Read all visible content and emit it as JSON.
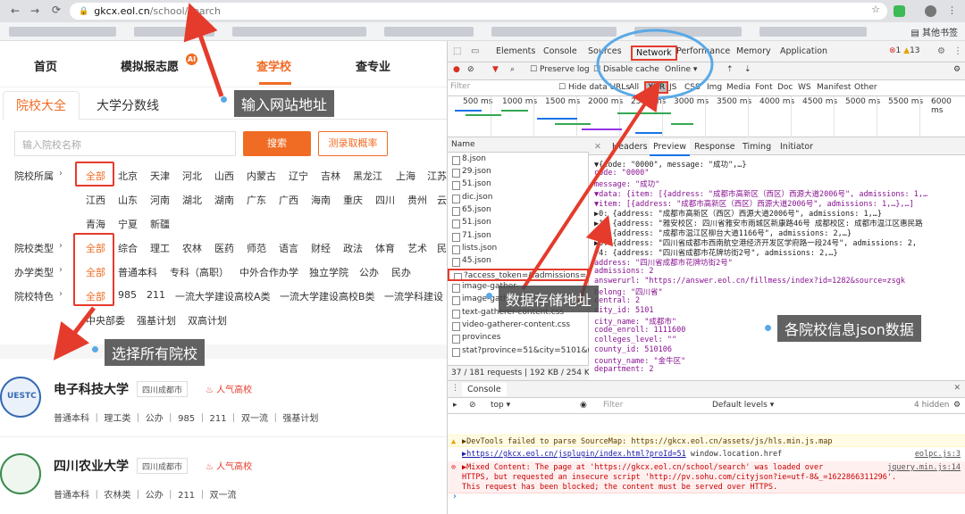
{
  "browser": {
    "url_host": "gkcx.eol.cn",
    "url_path": "/school/search",
    "bookmarks_folder": "其他书签"
  },
  "site": {
    "nav": [
      "首页",
      "模拟报志愿",
      "查学校",
      "查专业"
    ],
    "nav_badge": "AI",
    "tabs": [
      "院校大全",
      "大学分数线"
    ],
    "search_placeholder": "输入院校名称",
    "search_button": "搜索",
    "test_button": "测录取概率",
    "filters": {
      "location": {
        "label": "院校所属",
        "options": [
          "全部",
          "北京",
          "天津",
          "河北",
          "山西",
          "内蒙古",
          "辽宁",
          "吉林",
          "黑龙江",
          "上海",
          "江苏",
          "江西",
          "山东",
          "河南",
          "湖北",
          "湖南",
          "广东",
          "广西",
          "海南",
          "重庆",
          "四川",
          "贵州",
          "云",
          "青海",
          "宁夏",
          "新疆"
        ]
      },
      "type": {
        "label": "院校类型",
        "options": [
          "全部",
          "综合",
          "理工",
          "农林",
          "医药",
          "师范",
          "语言",
          "财经",
          "政法",
          "体育",
          "艺术",
          "民"
        ]
      },
      "level": {
        "label": "办学类型",
        "options": [
          "全部",
          "普通本科",
          "专科（高职）",
          "中外合作办学",
          "独立学院",
          "公办",
          "民办"
        ]
      },
      "feature": {
        "label": "院校特色",
        "options": [
          "全部",
          "985",
          "211",
          "一流大学建设高校A类",
          "一流大学建设高校B类",
          "一流学科建设",
          "中央部委",
          "强基计划",
          "双高计划"
        ]
      }
    },
    "schools": [
      {
        "name": "电子科技大学",
        "city": "四川成都市",
        "hot": "人气高校",
        "logo_text": "UESTC",
        "tags": [
          "普通本科",
          "理工类",
          "公办",
          "985",
          "211",
          "双一流",
          "强基计划"
        ]
      },
      {
        "name": "四川农业大学",
        "city": "四川成都市",
        "hot": "人气高校",
        "logo_text": "",
        "tags": [
          "普通本科",
          "农林类",
          "公办",
          "211",
          "双一流"
        ]
      }
    ]
  },
  "devtools": {
    "tabs": [
      "Elements",
      "Console",
      "Sources",
      "Network",
      "Performance",
      "Memory",
      "Application"
    ],
    "errors": "1",
    "warnings": "13",
    "toolbar": [
      "Preserve log",
      "Disable cache",
      "Online"
    ],
    "filter_placeholder": "Filter",
    "type_filters": [
      "Hide data URLs",
      "All",
      "XHR",
      "JS",
      "CSS",
      "Img",
      "Media",
      "Font",
      "Doc",
      "WS",
      "Manifest",
      "Other"
    ],
    "timeline_ticks": [
      "500 ms",
      "1000 ms",
      "1500 ms",
      "2000 ms",
      "2500 ms",
      "3000 ms",
      "3500 ms",
      "4000 ms",
      "4500 ms",
      "5000 ms",
      "5500 ms",
      "6000 ms"
    ],
    "files_header": "Name",
    "files": [
      "8.json",
      "29.json",
      "51.json",
      "dic.json",
      "65.json",
      "51.json",
      "71.json",
      "lists.json",
      "45.json",
      "?access_token=&admissions=&c",
      "image-gather-",
      "image-gather-list.css",
      "text-gatherer-content.css",
      "video-gatherer-content.css",
      "provinces",
      "stat?province=51&city=5101&uid."
    ],
    "status": "37 / 181 requests",
    "transferred": "192 KB / 254 KB",
    "detail_tabs": [
      "Headers",
      "Preview",
      "Response",
      "Timing",
      "Initiator"
    ],
    "preview_lines": [
      "▼{code: \"0000\", message: \"成功\",…}",
      "  code: \"0000\"",
      "  message: \"成功\"",
      "▼data: {item: [{address: \"成都市高新区（西区）西源大道2006号\", admissions: 1,…",
      "  ▼item: [{address: \"成都市高新区（西区）西源大道2006号\", admissions: 1,…},…]",
      "    ▶0: {address: \"成都市高新区（西区）西源大道2006号\", admissions: 1,…}",
      "    ▶1: {address: \"雅安校区: 四川省雅安市雨城区新康路46号 成都校区: 成都市温江区惠民路",
      "    ▶2: {address: \"成都市温江区柳台大道1166号\", admissions: 2,…}",
      "    ▶3: {address: \"四川省成都市西南航空港经济开发区学府路一段24号\", admissions: 2,",
      "    ▼4: {address: \"四川省成都市花牌坊街2号\", admissions: 2,…}",
      "        address: \"四川省成都市花牌坊街2号\"",
      "        admissions: 2",
      "        answerurl: \"https://answer.eol.cn/fillmess/index?id=1282&source=zsgk",
      "        belong: \"四川省\"",
      "        central: 2",
      "        city_id: 5101",
      "        city_name: \"成都市\"",
      "        code_enroll: 1111600",
      "        colleges_level: \"\"",
      "        county_id: 510106",
      "        county_name: \"金牛区\"",
      "        department: 2"
    ],
    "console_label": "Console",
    "console_context": "top",
    "console_filter": "Filter",
    "console_levels": "Default levels",
    "hidden": "4 hidden",
    "console_warn": "▶DevTools failed to parse SourceMap: https://gkcx.eol.cn/assets/js/hls.min.js.map",
    "console_log_link": "▶https://gkcx.eol.cn/jsplugin/index.html?proId=51",
    "console_log_rest": " window.location.href",
    "console_log_src": "eolpc.js:3",
    "console_err_1": "▶Mixed Content: The page at 'https://gkcx.eol.cn/school/search' was loaded over",
    "console_err_src": "jquery.min.js:14",
    "console_err_2": "HTTPS, but requested an insecure script 'http://pv.sohu.com/cityjson?ie=utf-8&_=1622866311296'.",
    "console_err_3": "This request has been blocked; the content must be served over HTTPS."
  },
  "annotations": {
    "url_hint": "输入网站地址",
    "data_address": "数据存储地址",
    "json_hint": "各院校信息json数据",
    "select_all": "选择所有院校"
  },
  "colors": {
    "accent": "#f06c24",
    "annotation_red": "#e53b2c",
    "annotation_blue": "#5aa9e6"
  }
}
